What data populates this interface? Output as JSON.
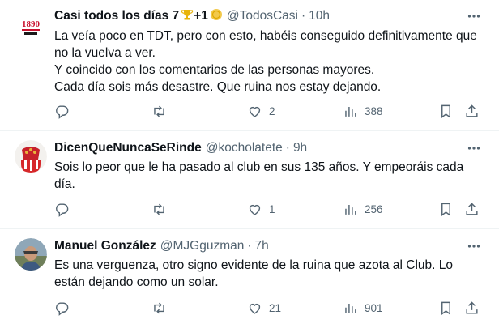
{
  "tweets": [
    {
      "name": "Casi todos los días 7",
      "name_suffix": "+1",
      "handle": "@TodosCasi",
      "time": "10h",
      "lines": [
        "La veía poco en TDT, pero con esto, habéis conseguido definitivamente que",
        "no la vuelva a ver.",
        "Y coincido con los comentarios de las personas mayores.",
        "Cada día sois más desastre. Que ruina nos estay dejando."
      ],
      "replies": "",
      "reposts": "",
      "likes": "2",
      "views": "388",
      "avatar_text": "1890"
    },
    {
      "name": "DicenQueNuncaSeRinde",
      "handle": "@kocholatete",
      "time": "9h",
      "lines": [
        "Sois lo peor que le ha pasado al club en sus 135 años. Y empeoráis cada",
        "día."
      ],
      "replies": "",
      "reposts": "",
      "likes": "1",
      "views": "256"
    },
    {
      "name": "Manuel González",
      "handle": "@MJGguzman",
      "time": "7h",
      "lines": [
        "Es una verguenza, otro signo evidente de la ruina que azota al Club. Lo",
        "están dejando como un solar."
      ],
      "replies": "",
      "reposts": "",
      "likes": "21",
      "views": "901"
    }
  ],
  "separator": "·",
  "colors": {
    "text": "#0f1419",
    "secondary": "#536471",
    "divider": "#eff3f4",
    "trophy": "#e8b40c",
    "coin": "#f2c94c"
  },
  "icons": [
    "more-icon",
    "reply-icon",
    "repost-icon",
    "like-icon",
    "views-icon",
    "bookmark-icon",
    "share-icon",
    "trophy-icon",
    "coin-icon"
  ]
}
